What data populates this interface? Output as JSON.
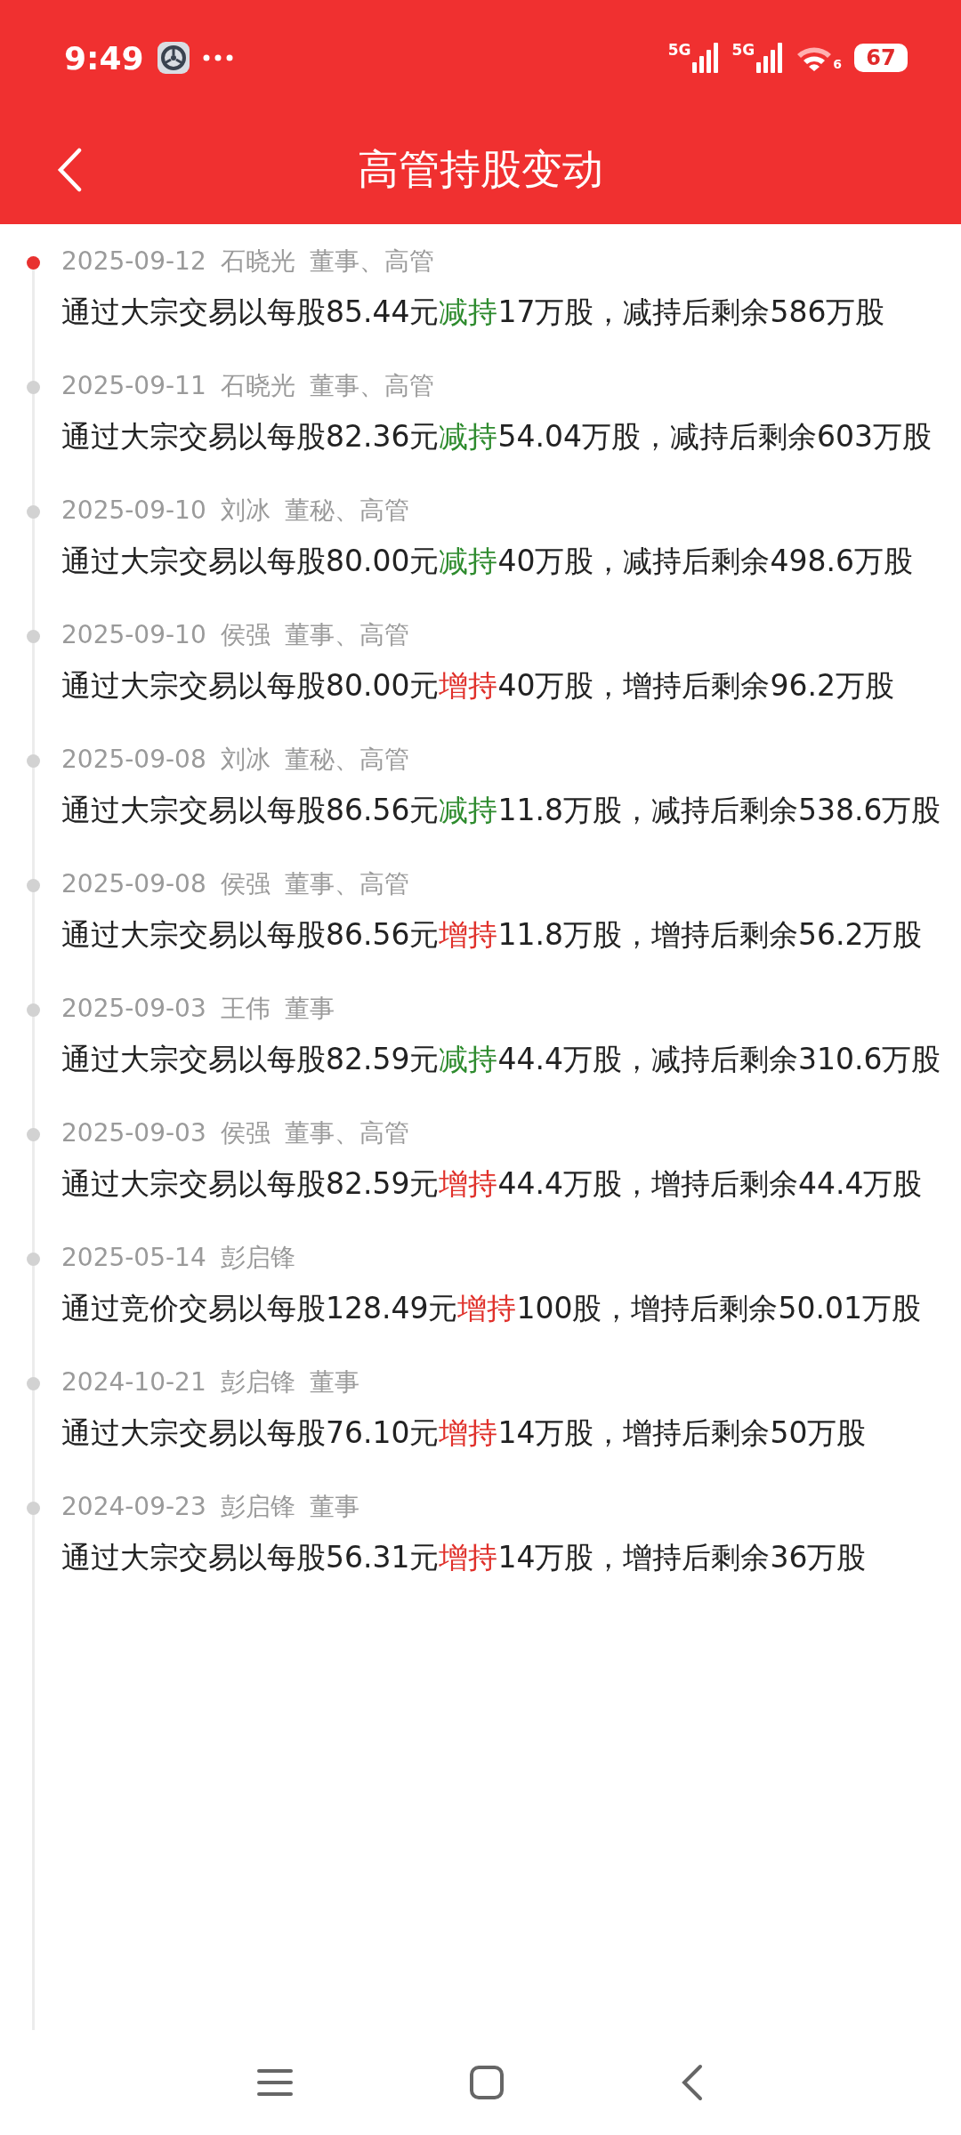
{
  "status_bar": {
    "time": "9:49",
    "networks": [
      "5G",
      "5G"
    ],
    "wifi_label": "6",
    "battery": "67"
  },
  "header": {
    "title": "高管持股变动"
  },
  "records": [
    {
      "date": "2025-09-12",
      "name": "石晓光",
      "role": "董事、高管",
      "latest": true,
      "prefix": "通过大宗交易以每股85.44元",
      "action": "减持",
      "kind": "decrease",
      "suffix": "17万股，减持后剩余586万股"
    },
    {
      "date": "2025-09-11",
      "name": "石晓光",
      "role": "董事、高管",
      "latest": false,
      "prefix": "通过大宗交易以每股82.36元",
      "action": "减持",
      "kind": "decrease",
      "suffix": "54.04万股，减持后剩余603万股"
    },
    {
      "date": "2025-09-10",
      "name": "刘冰",
      "role": "董秘、高管",
      "latest": false,
      "prefix": "通过大宗交易以每股80.00元",
      "action": "减持",
      "kind": "decrease",
      "suffix": "40万股，减持后剩余498.6万股"
    },
    {
      "date": "2025-09-10",
      "name": "侯强",
      "role": "董事、高管",
      "latest": false,
      "prefix": "通过大宗交易以每股80.00元",
      "action": "增持",
      "kind": "increase",
      "suffix": "40万股，增持后剩余96.2万股"
    },
    {
      "date": "2025-09-08",
      "name": "刘冰",
      "role": "董秘、高管",
      "latest": false,
      "prefix": "通过大宗交易以每股86.56元",
      "action": "减持",
      "kind": "decrease",
      "suffix": "11.8万股，减持后剩余538.6万股"
    },
    {
      "date": "2025-09-08",
      "name": "侯强",
      "role": "董事、高管",
      "latest": false,
      "prefix": "通过大宗交易以每股86.56元",
      "action": "增持",
      "kind": "increase",
      "suffix": "11.8万股，增持后剩余56.2万股"
    },
    {
      "date": "2025-09-03",
      "name": "王伟",
      "role": "董事",
      "latest": false,
      "prefix": "通过大宗交易以每股82.59元",
      "action": "减持",
      "kind": "decrease",
      "suffix": "44.4万股，减持后剩余310.6万股"
    },
    {
      "date": "2025-09-03",
      "name": "侯强",
      "role": "董事、高管",
      "latest": false,
      "prefix": "通过大宗交易以每股82.59元",
      "action": "增持",
      "kind": "increase",
      "suffix": "44.4万股，增持后剩余44.4万股"
    },
    {
      "date": "2025-05-14",
      "name": "彭启锋",
      "latest": false,
      "prefix": "通过竞价交易以每股128.49元",
      "action": "增持",
      "kind": "increase",
      "suffix": "100股，增持后剩余50.01万股"
    },
    {
      "date": "2024-10-21",
      "name": "彭启锋",
      "role": "董事",
      "latest": false,
      "prefix": "通过大宗交易以每股76.10元",
      "action": "增持",
      "kind": "increase",
      "suffix": "14万股，增持后剩余50万股"
    },
    {
      "date": "2024-09-23",
      "name": "彭启锋",
      "role": "董事",
      "latest": false,
      "prefix": "通过大宗交易以每股56.31元",
      "action": "增持",
      "kind": "increase",
      "suffix": "14万股，增持后剩余36万股"
    }
  ]
}
